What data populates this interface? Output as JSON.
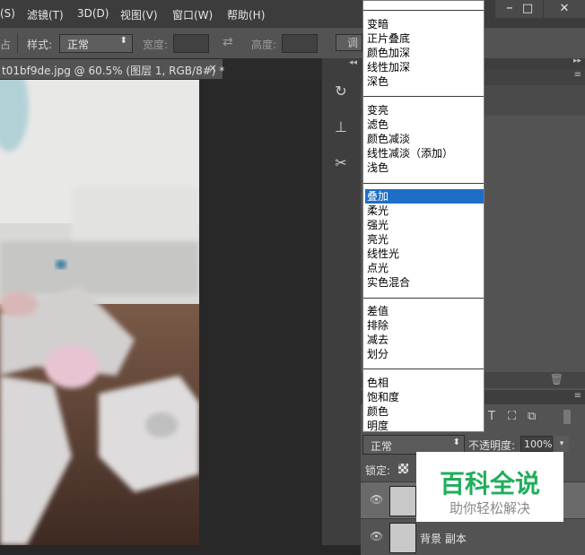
{
  "menubar": {
    "items": [
      "(S)",
      "滤镜(T)",
      "3D(D)",
      "视图(V)",
      "窗口(W)",
      "帮助(H)"
    ],
    "window_controls": [
      "−",
      "□",
      "✕"
    ]
  },
  "options": {
    "style_label": "样式:",
    "style_value": "正常",
    "width_label": "宽度:",
    "height_label": "高度:",
    "adjust_label": "调"
  },
  "document": {
    "tab_title": "t01bf9de.jpg @ 60.5% (图层 1, RGB/8#) *",
    "close": "×"
  },
  "blend_modes": {
    "groups": [
      [
        "变暗",
        "正片叠底",
        "颜色加深",
        "线性加深",
        "深色"
      ],
      [
        "变亮",
        "滤色",
        "颜色减淡",
        "线性减淡（添加）",
        "浅色"
      ],
      [
        "叠加",
        "柔光",
        "强光",
        "亮光",
        "线性光",
        "点光",
        "实色混合"
      ],
      [
        "差值",
        "排除",
        "减去",
        "划分"
      ],
      [
        "色相",
        "饱和度",
        "颜色",
        "明度"
      ]
    ],
    "selected": "叠加"
  },
  "layers_panel": {
    "blend_value": "正常",
    "opacity_label": "不透明度:",
    "opacity_value": "100%",
    "lock_label": "锁定:",
    "layers": [
      {
        "name": ""
      },
      {
        "name": "背景 副本"
      }
    ]
  },
  "watermark": {
    "title": "百科全说",
    "subtitle": "助你轻松解决"
  }
}
